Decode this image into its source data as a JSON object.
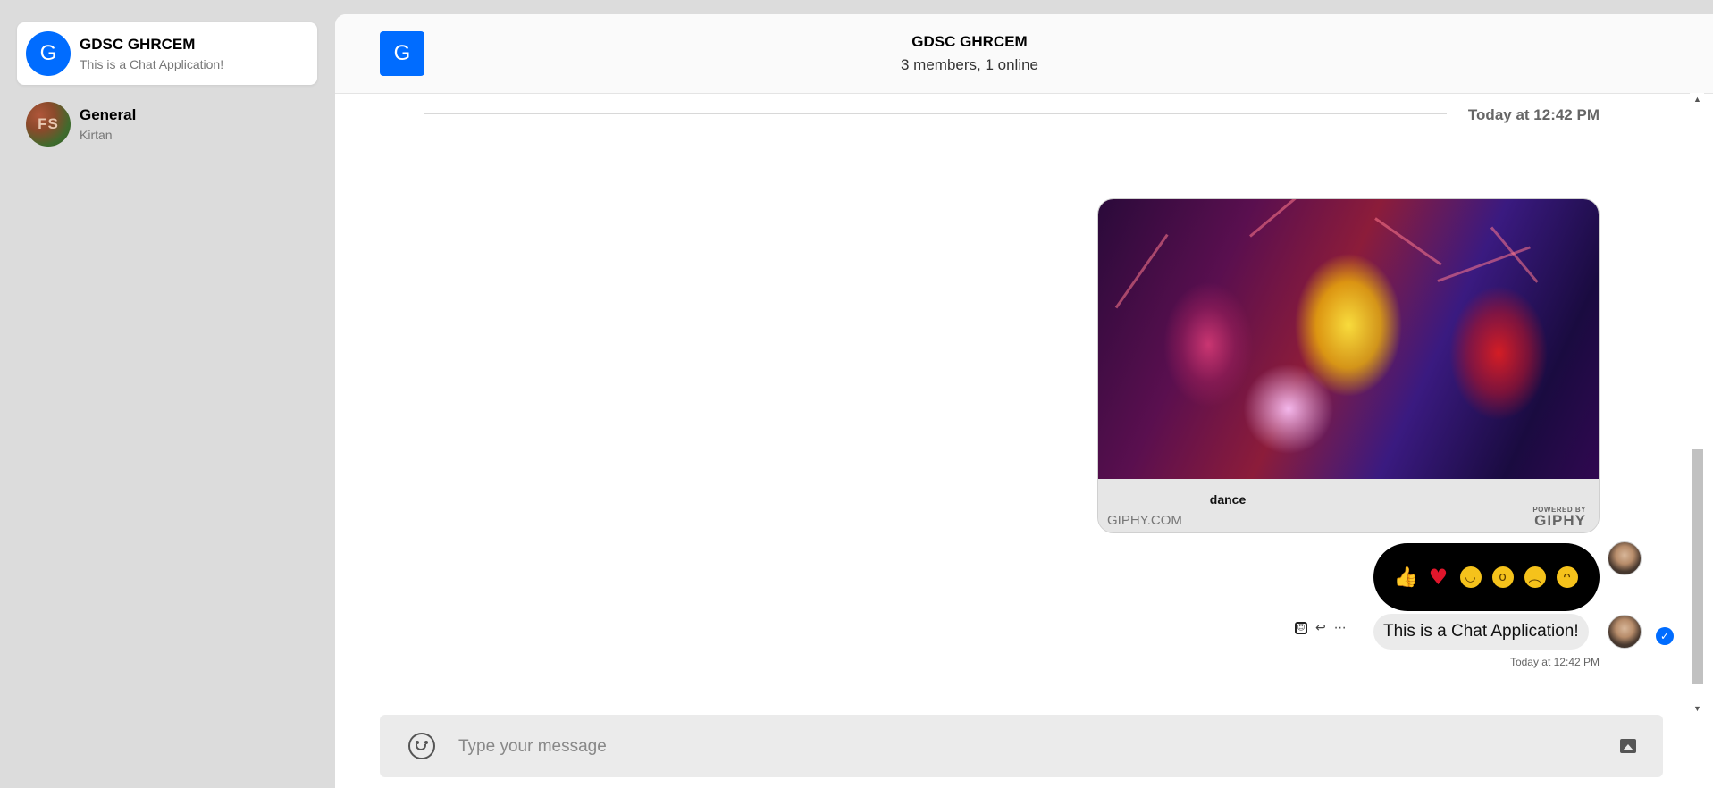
{
  "sidebar": {
    "channels": [
      {
        "avatar_letter": "G",
        "name": "GDSC GHRCEM",
        "preview": "This is a Chat Application!"
      },
      {
        "avatar_letter": "FS",
        "name": "General",
        "preview": "Kirtan"
      }
    ]
  },
  "header": {
    "avatar_letter": "G",
    "title": "GDSC GHRCEM",
    "subtitle": "3 members, 1 online"
  },
  "messages": {
    "date_divider": "Today at 12:42 PM",
    "giphy": {
      "title": "dance",
      "source": "GIPHY.COM",
      "badge_small": "POWERED BY",
      "badge_big": "GIPHY"
    },
    "reactions": [
      "like",
      "love",
      "haha",
      "wow",
      "sad",
      "angry"
    ],
    "text_message": {
      "text": "This is a Chat Application!",
      "time": "Today at 12:42 PM",
      "status": "read"
    },
    "actions": [
      "react",
      "reply",
      "more"
    ]
  },
  "composer": {
    "placeholder": "Type your message"
  },
  "colors": {
    "accent": "#006cff",
    "sidebar_bg": "#dcdcdc",
    "bubble_bg": "#ebebeb"
  },
  "icons": {
    "emoji": "smile-icon",
    "image_upload": "image-icon",
    "read_receipt": "check-icon"
  }
}
